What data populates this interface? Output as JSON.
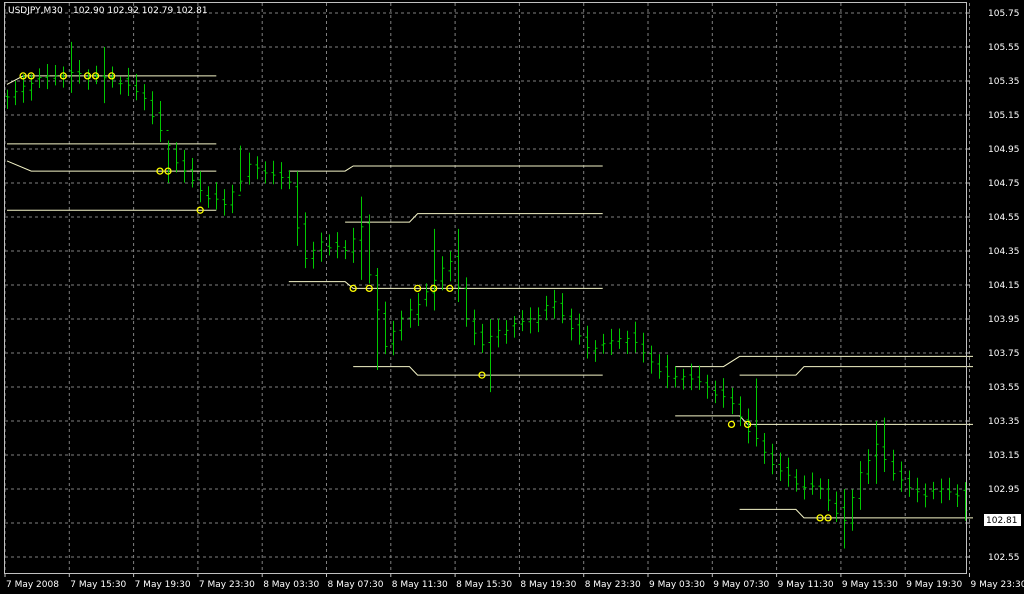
{
  "header": {
    "symbol": "USDJPY,M30",
    "ohlc": "102.90 102.92 102.79 102.81"
  },
  "colors": {
    "background": "#000000",
    "frame": "#c0c0c0",
    "grid": "#808080",
    "bar": "#00c800",
    "level_line": "#f5f5c8",
    "marker": "#ffff00",
    "price_tag_bg": "#ffffff",
    "price_tag_text": "#000000"
  },
  "chart_data": {
    "type": "ohlc-bars",
    "y_range": [
      102.5,
      105.85
    ],
    "y_ticks": [
      "105.75",
      "105.55",
      "105.35",
      "105.15",
      "104.95",
      "104.75",
      "104.55",
      "104.35",
      "104.15",
      "103.95",
      "103.75",
      "103.55",
      "103.35",
      "103.15",
      "102.95",
      "102.75",
      "102.55"
    ],
    "x_labels": [
      "7 May 2008",
      "7 May 15:30",
      "7 May 19:30",
      "7 May 23:30",
      "8 May 03:30",
      "8 May 07:30",
      "8 May 11:30",
      "8 May 15:30",
      "8 May 19:30",
      "8 May 23:30",
      "9 May 03:30",
      "9 May 07:30",
      "9 May 11:30",
      "9 May 15:30",
      "9 May 19:30",
      "9 May 23:30"
    ],
    "bar_count": 120,
    "current_price": "102.81",
    "anchors": [
      [
        0,
        105.25
      ],
      [
        3,
        105.35
      ],
      [
        7,
        105.4
      ],
      [
        10,
        105.38
      ],
      [
        14,
        105.35
      ],
      [
        17,
        105.25
      ],
      [
        19,
        105.05
      ],
      [
        21,
        104.88
      ],
      [
        24,
        104.7
      ],
      [
        27,
        104.62
      ],
      [
        30,
        104.85
      ],
      [
        33,
        104.8
      ],
      [
        35,
        104.75
      ],
      [
        36,
        104.5
      ],
      [
        37,
        104.3
      ],
      [
        39,
        104.4
      ],
      [
        42,
        104.35
      ],
      [
        44,
        104.5
      ],
      [
        45,
        104.2
      ],
      [
        46,
        104.0
      ],
      [
        47,
        103.8
      ],
      [
        49,
        103.95
      ],
      [
        52,
        104.1
      ],
      [
        54,
        104.25
      ],
      [
        55,
        104.3
      ],
      [
        57,
        103.95
      ],
      [
        59,
        103.8
      ],
      [
        61,
        103.88
      ],
      [
        65,
        103.95
      ],
      [
        68,
        104.05
      ],
      [
        70,
        103.9
      ],
      [
        72,
        103.78
      ],
      [
        74,
        103.8
      ],
      [
        77,
        103.85
      ],
      [
        80,
        103.7
      ],
      [
        82,
        103.6
      ],
      [
        84,
        103.62
      ],
      [
        87,
        103.55
      ],
      [
        90,
        103.45
      ],
      [
        92,
        103.3
      ],
      [
        95,
        103.1
      ],
      [
        98,
        102.98
      ],
      [
        101,
        102.95
      ],
      [
        103,
        102.82
      ],
      [
        104,
        102.75
      ],
      [
        106,
        103.05
      ],
      [
        108,
        103.2
      ],
      [
        110,
        103.05
      ],
      [
        112,
        102.95
      ],
      [
        114,
        102.92
      ],
      [
        116,
        102.95
      ],
      [
        118,
        102.92
      ],
      [
        119,
        102.81
      ]
    ],
    "wicks": [
      [
        8,
        105.58,
        105.28
      ],
      [
        12,
        105.55,
        105.22
      ],
      [
        20,
        105.0,
        104.75
      ],
      [
        29,
        104.97,
        104.7
      ],
      [
        36,
        104.82,
        104.38
      ],
      [
        44,
        104.67,
        104.18
      ],
      [
        46,
        104.25,
        103.65
      ],
      [
        53,
        104.48,
        104.0
      ],
      [
        56,
        104.48,
        104.05
      ],
      [
        60,
        103.95,
        103.52
      ],
      [
        93,
        103.6,
        103.2
      ],
      [
        104,
        102.95,
        102.6
      ],
      [
        108,
        103.35,
        102.98
      ],
      [
        109,
        103.37,
        103.05
      ]
    ],
    "level_segments": [
      {
        "points": [
          [
            0,
            105.33
          ],
          [
            2,
            105.38
          ],
          [
            26,
            105.38
          ]
        ]
      },
      {
        "points": [
          [
            0,
            104.98
          ],
          [
            26,
            104.98
          ]
        ]
      },
      {
        "points": [
          [
            0,
            104.88
          ],
          [
            3,
            104.82
          ],
          [
            26,
            104.82
          ]
        ]
      },
      {
        "points": [
          [
            0,
            104.59
          ],
          [
            26,
            104.59
          ]
        ]
      },
      {
        "points": [
          [
            35,
            104.82
          ],
          [
            42,
            104.82
          ],
          [
            43,
            104.85
          ],
          [
            74,
            104.85
          ]
        ]
      },
      {
        "points": [
          [
            42,
            104.52
          ],
          [
            50,
            104.52
          ],
          [
            51,
            104.57
          ],
          [
            74,
            104.57
          ]
        ]
      },
      {
        "points": [
          [
            35,
            104.17
          ],
          [
            42,
            104.17
          ],
          [
            43,
            104.13
          ],
          [
            74,
            104.13
          ]
        ]
      },
      {
        "points": [
          [
            43,
            103.67
          ],
          [
            50,
            103.67
          ],
          [
            51,
            103.62
          ],
          [
            74,
            103.62
          ]
        ]
      },
      {
        "points": [
          [
            83,
            103.67
          ],
          [
            89,
            103.67
          ],
          [
            91,
            103.73
          ],
          [
            120,
            103.73
          ]
        ]
      },
      {
        "points": [
          [
            91,
            103.62
          ],
          [
            98,
            103.62
          ],
          [
            99,
            103.67
          ],
          [
            120,
            103.67
          ]
        ]
      },
      {
        "points": [
          [
            83,
            103.38
          ],
          [
            91,
            103.38
          ],
          [
            92,
            103.33
          ],
          [
            120,
            103.33
          ]
        ]
      },
      {
        "points": [
          [
            91,
            102.83
          ],
          [
            98,
            102.83
          ],
          [
            99,
            102.78
          ],
          [
            120,
            102.78
          ]
        ]
      }
    ],
    "markers": [
      [
        2,
        105.38
      ],
      [
        3,
        105.38
      ],
      [
        7,
        105.38
      ],
      [
        10,
        105.38
      ],
      [
        11,
        105.38
      ],
      [
        13,
        105.38
      ],
      [
        19,
        104.82
      ],
      [
        20,
        104.82
      ],
      [
        24,
        104.59
      ],
      [
        43,
        104.13
      ],
      [
        45,
        104.13
      ],
      [
        51,
        104.13
      ],
      [
        53,
        104.13
      ],
      [
        55,
        104.13
      ],
      [
        59,
        103.62
      ],
      [
        90,
        103.33
      ],
      [
        92,
        103.33
      ],
      [
        101,
        102.78
      ],
      [
        102,
        102.78
      ]
    ]
  }
}
